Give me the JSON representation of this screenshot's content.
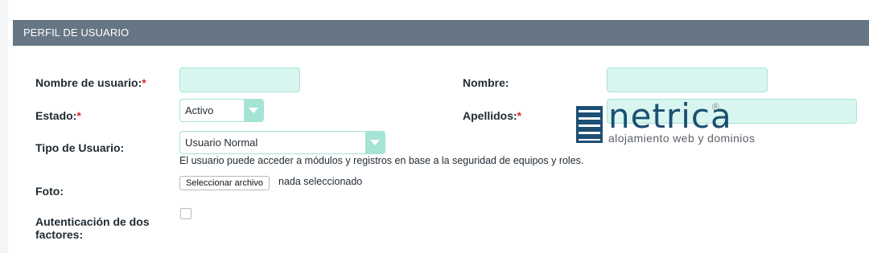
{
  "panel": {
    "title": "PERFIL DE USUARIO"
  },
  "form": {
    "username": {
      "label": "Nombre de usuario:",
      "required_mark": "*",
      "value": ""
    },
    "status": {
      "label": "Estado:",
      "required_mark": "*",
      "selected": "Activo"
    },
    "user_type": {
      "label": "Tipo de Usuario:",
      "selected": "Usuario Normal",
      "help": "El usuario puede acceder a módulos y registros en base a la seguridad de equipos y roles."
    },
    "photo": {
      "label": "Foto:",
      "button": "Seleccionar archivo",
      "status": "nada seleccionado"
    },
    "two_factor": {
      "label_line1": "Autenticación de dos",
      "label_line2": "factores:",
      "checked": false
    },
    "first_name": {
      "label": "Nombre:",
      "value": ""
    },
    "last_name": {
      "label": "Apellidos:",
      "required_mark": "*",
      "value": ""
    }
  },
  "watermark": {
    "word": "netrica",
    "reg": "®",
    "tagline": "alojamiento web y dominios"
  },
  "colors": {
    "header_bg": "#677684",
    "input_bg": "#d8f6ef",
    "accent": "#a5e3d5",
    "required": "#e0262e",
    "logo": "#1c4f73"
  }
}
